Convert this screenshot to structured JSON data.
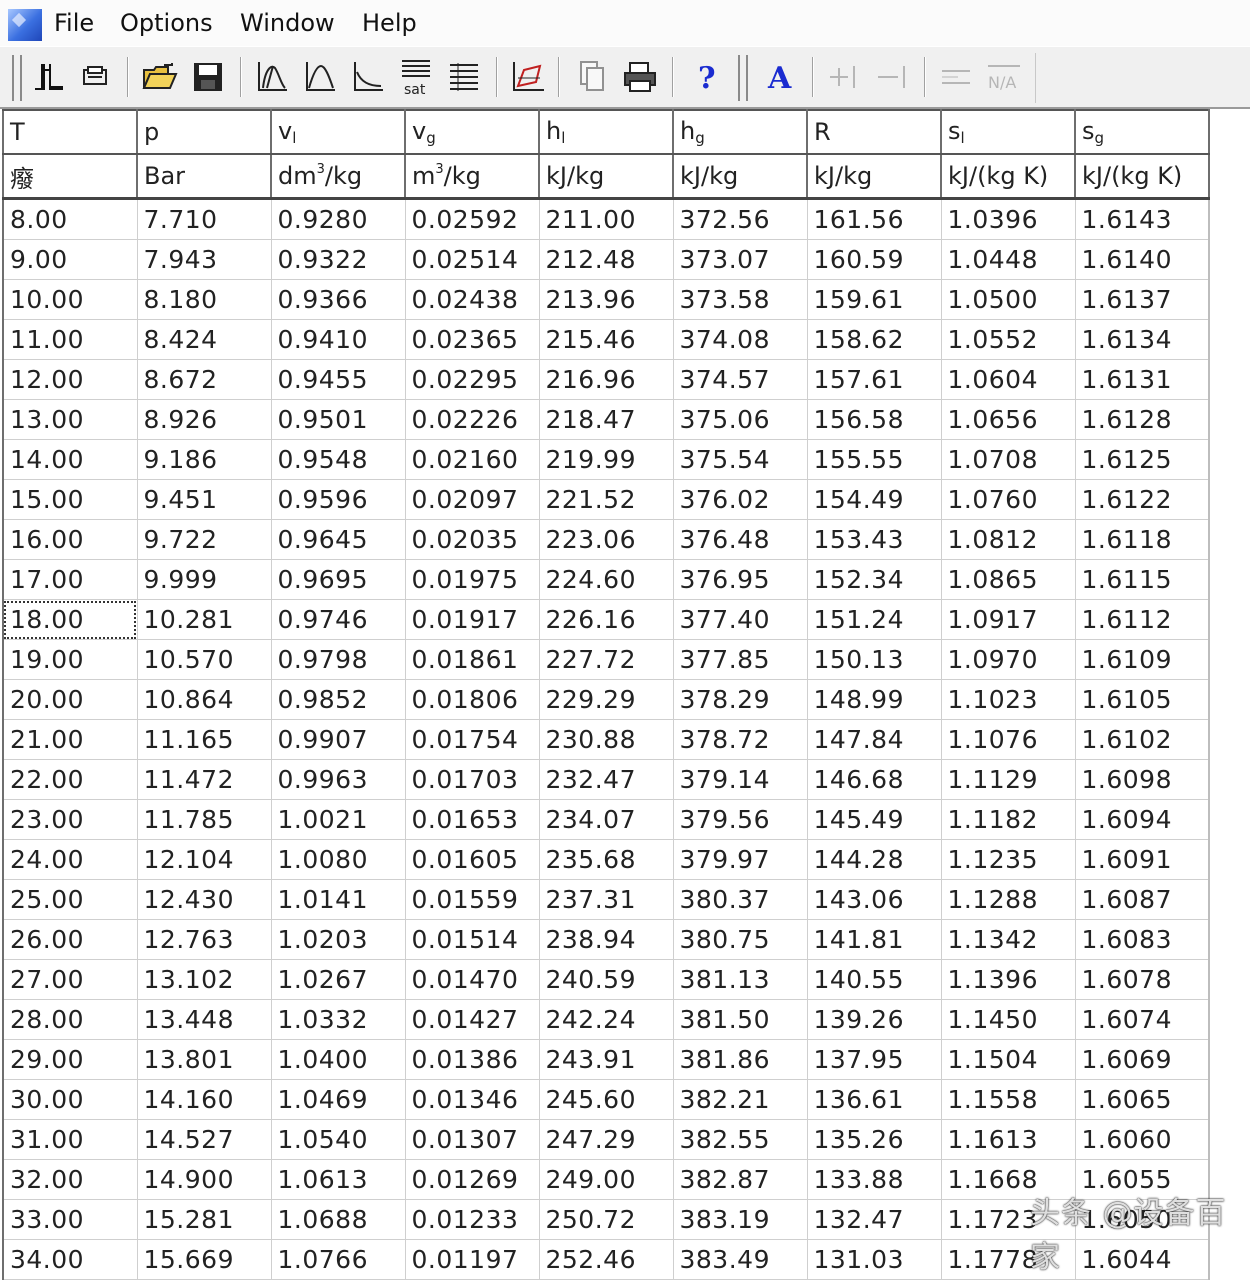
{
  "menu": {
    "items": [
      "File",
      "Options",
      "Window",
      "Help"
    ]
  },
  "toolbar": {
    "sat_label": "sat",
    "na_label": "N/A",
    "icons": [
      "refrigerant-select-icon",
      "print-setup-icon",
      "open-folder-icon",
      "save-icon",
      "log-ph-diagram-icon",
      "ts-diagram-icon",
      "hs-diagram-icon",
      "saturation-table-icon",
      "table-icon",
      "cycle-diagram-icon",
      "copy-icon",
      "print-icon",
      "help-icon",
      "font-icon",
      "add-column-icon",
      "remove-column-icon",
      "align-icon",
      "na-icon"
    ]
  },
  "table": {
    "headers": [
      {
        "main": "T",
        "sub": ""
      },
      {
        "main": "p",
        "sub": ""
      },
      {
        "main": "v",
        "sub": "l"
      },
      {
        "main": "v",
        "sub": "g"
      },
      {
        "main": "h",
        "sub": "l"
      },
      {
        "main": "h",
        "sub": "g"
      },
      {
        "main": "R",
        "sub": ""
      },
      {
        "main": "s",
        "sub": "l"
      },
      {
        "main": "s",
        "sub": "g"
      }
    ],
    "units": [
      {
        "pre": "癈",
        "sup": "",
        "post": ""
      },
      {
        "pre": "Bar",
        "sup": "",
        "post": ""
      },
      {
        "pre": "dm",
        "sup": "3",
        "post": "/kg"
      },
      {
        "pre": "m",
        "sup": "3",
        "post": "/kg"
      },
      {
        "pre": "kJ/kg",
        "sup": "",
        "post": ""
      },
      {
        "pre": "kJ/kg",
        "sup": "",
        "post": ""
      },
      {
        "pre": "kJ/kg",
        "sup": "",
        "post": ""
      },
      {
        "pre": "kJ/(kg K)",
        "sup": "",
        "post": ""
      },
      {
        "pre": "kJ/(kg K)",
        "sup": "",
        "post": ""
      }
    ],
    "focused_row": 10,
    "rows": [
      [
        "8.00",
        "7.710",
        "0.9280",
        "0.02592",
        "211.00",
        "372.56",
        "161.56",
        "1.0396",
        "1.6143"
      ],
      [
        "9.00",
        "7.943",
        "0.9322",
        "0.02514",
        "212.48",
        "373.07",
        "160.59",
        "1.0448",
        "1.6140"
      ],
      [
        "10.00",
        "8.180",
        "0.9366",
        "0.02438",
        "213.96",
        "373.58",
        "159.61",
        "1.0500",
        "1.6137"
      ],
      [
        "11.00",
        "8.424",
        "0.9410",
        "0.02365",
        "215.46",
        "374.08",
        "158.62",
        "1.0552",
        "1.6134"
      ],
      [
        "12.00",
        "8.672",
        "0.9455",
        "0.02295",
        "216.96",
        "374.57",
        "157.61",
        "1.0604",
        "1.6131"
      ],
      [
        "13.00",
        "8.926",
        "0.9501",
        "0.02226",
        "218.47",
        "375.06",
        "156.58",
        "1.0656",
        "1.6128"
      ],
      [
        "14.00",
        "9.186",
        "0.9548",
        "0.02160",
        "219.99",
        "375.54",
        "155.55",
        "1.0708",
        "1.6125"
      ],
      [
        "15.00",
        "9.451",
        "0.9596",
        "0.02097",
        "221.52",
        "376.02",
        "154.49",
        "1.0760",
        "1.6122"
      ],
      [
        "16.00",
        "9.722",
        "0.9645",
        "0.02035",
        "223.06",
        "376.48",
        "153.43",
        "1.0812",
        "1.6118"
      ],
      [
        "17.00",
        "9.999",
        "0.9695",
        "0.01975",
        "224.60",
        "376.95",
        "152.34",
        "1.0865",
        "1.6115"
      ],
      [
        "18.00",
        "10.281",
        "0.9746",
        "0.01917",
        "226.16",
        "377.40",
        "151.24",
        "1.0917",
        "1.6112"
      ],
      [
        "19.00",
        "10.570",
        "0.9798",
        "0.01861",
        "227.72",
        "377.85",
        "150.13",
        "1.0970",
        "1.6109"
      ],
      [
        "20.00",
        "10.864",
        "0.9852",
        "0.01806",
        "229.29",
        "378.29",
        "148.99",
        "1.1023",
        "1.6105"
      ],
      [
        "21.00",
        "11.165",
        "0.9907",
        "0.01754",
        "230.88",
        "378.72",
        "147.84",
        "1.1076",
        "1.6102"
      ],
      [
        "22.00",
        "11.472",
        "0.9963",
        "0.01703",
        "232.47",
        "379.14",
        "146.68",
        "1.1129",
        "1.6098"
      ],
      [
        "23.00",
        "11.785",
        "1.0021",
        "0.01653",
        "234.07",
        "379.56",
        "145.49",
        "1.1182",
        "1.6094"
      ],
      [
        "24.00",
        "12.104",
        "1.0080",
        "0.01605",
        "235.68",
        "379.97",
        "144.28",
        "1.1235",
        "1.6091"
      ],
      [
        "25.00",
        "12.430",
        "1.0141",
        "0.01559",
        "237.31",
        "380.37",
        "143.06",
        "1.1288",
        "1.6087"
      ],
      [
        "26.00",
        "12.763",
        "1.0203",
        "0.01514",
        "238.94",
        "380.75",
        "141.81",
        "1.1342",
        "1.6083"
      ],
      [
        "27.00",
        "13.102",
        "1.0267",
        "0.01470",
        "240.59",
        "381.13",
        "140.55",
        "1.1396",
        "1.6078"
      ],
      [
        "28.00",
        "13.448",
        "1.0332",
        "0.01427",
        "242.24",
        "381.50",
        "139.26",
        "1.1450",
        "1.6074"
      ],
      [
        "29.00",
        "13.801",
        "1.0400",
        "0.01386",
        "243.91",
        "381.86",
        "137.95",
        "1.1504",
        "1.6069"
      ],
      [
        "30.00",
        "14.160",
        "1.0469",
        "0.01346",
        "245.60",
        "382.21",
        "136.61",
        "1.1558",
        "1.6065"
      ],
      [
        "31.00",
        "14.527",
        "1.0540",
        "0.01307",
        "247.29",
        "382.55",
        "135.26",
        "1.1613",
        "1.6060"
      ],
      [
        "32.00",
        "14.900",
        "1.0613",
        "0.01269",
        "249.00",
        "382.87",
        "133.88",
        "1.1668",
        "1.6055"
      ],
      [
        "33.00",
        "15.281",
        "1.0688",
        "0.01233",
        "250.72",
        "383.19",
        "132.47",
        "1.1723",
        "1.6050"
      ],
      [
        "34.00",
        "15.669",
        "1.0766",
        "0.01197",
        "252.46",
        "383.49",
        "131.03",
        "1.1778",
        "1.6044"
      ]
    ]
  },
  "watermark": "头条 @设备百家"
}
